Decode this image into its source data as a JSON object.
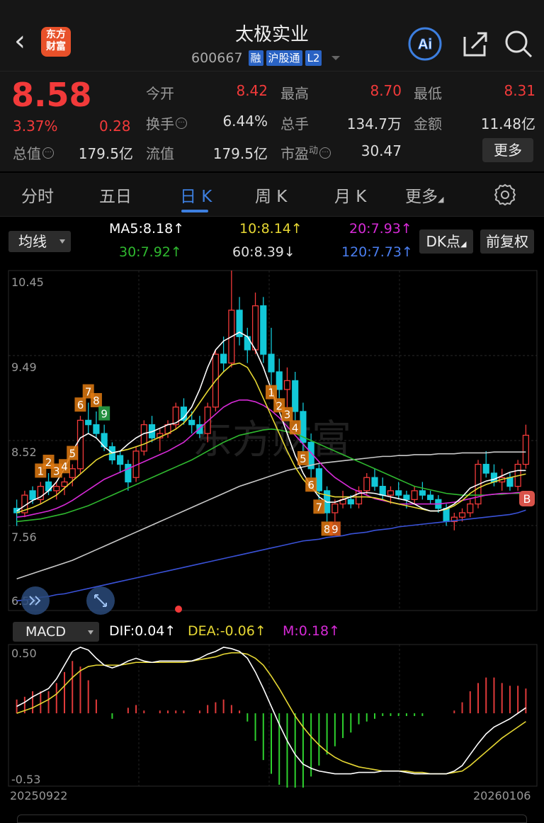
{
  "header": {
    "logo_line1": "东方",
    "logo_line2": "财富",
    "title": "太极实业",
    "code": "600667",
    "tags": [
      "融",
      "沪股通",
      "L2"
    ]
  },
  "quote": {
    "price": "8.58",
    "pct": "3.37%",
    "change": "0.28",
    "open_label": "今开",
    "open": "8.42",
    "high_label": "最高",
    "high": "8.70",
    "low_label": "最低",
    "low": "8.31",
    "turnover_label": "换手",
    "turnover": "6.44%",
    "volume_label": "总手",
    "volume": "134.7万",
    "amount_label": "金额",
    "amount": "11.48亿",
    "mktcap_label": "总值",
    "mktcap": "179.5亿",
    "float_label": "流值",
    "float_cap": "179.5亿",
    "pe_label": "市盈",
    "pe_sup": "动",
    "pe": "30.47",
    "more": "更多"
  },
  "tabs": [
    "分时",
    "五日",
    "日 K",
    "周 K",
    "月 K",
    "更多"
  ],
  "ma": {
    "select": "均线",
    "ma5": "MA5:8.18",
    "ma10": "10:8.14",
    "ma20": "20:7.93",
    "ma30": "30:7.92",
    "ma60": "60:8.39",
    "ma120": "120:7.73",
    "up_arrow": "↑",
    "down_arrow": "↓",
    "dk_btn": "DK点",
    "fq_btn": "前复权"
  },
  "colors": {
    "up": "#f23a3a",
    "down": "#12c8d8",
    "ma5": "#ffffff",
    "ma10": "#e6d733",
    "ma20": "#d62ad6",
    "ma30": "#2fb82f",
    "ma60": "#c8c8c8",
    "ma120": "#3a52d8",
    "accent": "#3d7fe0"
  },
  "chart_data": [
    {
      "type": "candlestick",
      "y_ticks": [
        "10.45",
        "9.49",
        "8.52",
        "7.56",
        "6.59"
      ],
      "ylim": [
        6.59,
        10.45
      ],
      "x_start": "20250922",
      "x_end": "20260106",
      "candles": [
        [
          7.75,
          7.85,
          7.55,
          7.7
        ],
        [
          7.7,
          7.95,
          7.65,
          7.9
        ],
        [
          7.95,
          8.0,
          7.8,
          7.85
        ],
        [
          7.85,
          8.05,
          7.8,
          8.0
        ],
        [
          8.05,
          8.15,
          7.9,
          7.95
        ],
        [
          7.95,
          8.05,
          7.85,
          8.0
        ],
        [
          8.0,
          8.1,
          7.9,
          8.05
        ],
        [
          8.1,
          8.25,
          8.0,
          8.2
        ],
        [
          8.2,
          8.8,
          8.15,
          8.75
        ],
        [
          8.75,
          8.95,
          8.6,
          8.7
        ],
        [
          8.7,
          8.85,
          8.55,
          8.6
        ],
        [
          8.6,
          8.7,
          8.4,
          8.45
        ],
        [
          8.45,
          8.5,
          8.25,
          8.3
        ],
        [
          8.35,
          8.4,
          8.15,
          8.25
        ],
        [
          8.25,
          8.3,
          7.95,
          8.05
        ],
        [
          8.1,
          8.45,
          8.05,
          8.4
        ],
        [
          8.4,
          8.75,
          8.35,
          8.7
        ],
        [
          8.7,
          8.8,
          8.5,
          8.55
        ],
        [
          8.55,
          8.65,
          8.4,
          8.6
        ],
        [
          8.6,
          8.75,
          8.55,
          8.7
        ],
        [
          8.7,
          8.95,
          8.65,
          8.9
        ],
        [
          8.9,
          9.0,
          8.7,
          8.75
        ],
        [
          8.75,
          8.85,
          8.6,
          8.7
        ],
        [
          8.7,
          8.8,
          8.55,
          8.6
        ],
        [
          8.6,
          8.95,
          8.5,
          8.9
        ],
        [
          8.9,
          9.55,
          8.85,
          9.5
        ],
        [
          9.5,
          9.7,
          9.3,
          9.4
        ],
        [
          9.4,
          10.45,
          9.35,
          10.0
        ],
        [
          10.0,
          10.15,
          9.6,
          9.7
        ],
        [
          9.7,
          9.8,
          9.4,
          9.55
        ],
        [
          9.55,
          10.2,
          9.5,
          10.05
        ],
        [
          10.05,
          10.15,
          9.4,
          9.5
        ],
        [
          9.5,
          9.8,
          9.15,
          9.3
        ],
        [
          9.3,
          9.45,
          9.0,
          9.1
        ],
        [
          9.1,
          9.35,
          8.9,
          9.2
        ],
        [
          9.2,
          9.3,
          8.75,
          8.85
        ],
        [
          8.85,
          8.95,
          8.4,
          8.5
        ],
        [
          8.5,
          8.6,
          8.1,
          8.2
        ],
        [
          8.2,
          8.25,
          7.85,
          7.95
        ],
        [
          7.95,
          8.0,
          7.6,
          7.7
        ],
        [
          7.7,
          7.85,
          7.6,
          7.8
        ],
        [
          7.8,
          7.95,
          7.75,
          7.85
        ],
        [
          7.85,
          7.9,
          7.75,
          7.8
        ],
        [
          7.8,
          8.0,
          7.75,
          7.95
        ],
        [
          7.95,
          8.15,
          7.9,
          8.1
        ],
        [
          8.1,
          8.2,
          7.95,
          8.0
        ],
        [
          8.0,
          8.1,
          7.85,
          7.9
        ],
        [
          7.9,
          8.0,
          7.8,
          7.95
        ],
        [
          7.95,
          8.05,
          7.85,
          7.9
        ],
        [
          7.9,
          7.95,
          7.75,
          7.85
        ],
        [
          7.85,
          8.0,
          7.8,
          7.95
        ],
        [
          7.95,
          8.05,
          7.85,
          7.9
        ],
        [
          7.9,
          7.95,
          7.8,
          7.85
        ],
        [
          7.85,
          7.9,
          7.7,
          7.75
        ],
        [
          7.75,
          7.8,
          7.55,
          7.6
        ],
        [
          7.6,
          7.7,
          7.5,
          7.65
        ],
        [
          7.65,
          7.75,
          7.6,
          7.7
        ],
        [
          7.7,
          7.85,
          7.65,
          7.8
        ],
        [
          7.8,
          8.3,
          7.75,
          8.25
        ],
        [
          8.25,
          8.4,
          8.1,
          8.15
        ],
        [
          8.15,
          8.25,
          8.0,
          8.05
        ],
        [
          8.05,
          8.2,
          7.95,
          8.1
        ],
        [
          8.1,
          8.15,
          7.95,
          8.0
        ],
        [
          8.0,
          8.3,
          7.95,
          8.25
        ],
        [
          8.25,
          8.7,
          8.2,
          8.58
        ]
      ],
      "ma5": [
        7.72,
        7.78,
        7.84,
        7.88,
        7.95,
        8.05,
        8.2,
        8.4,
        8.55,
        8.6,
        8.55,
        8.45,
        8.38,
        8.4,
        8.48,
        8.55,
        8.6,
        8.62,
        8.66,
        8.7,
        8.72,
        8.78,
        8.9,
        9.1,
        9.35,
        9.55,
        9.65,
        9.7,
        9.75,
        9.7,
        9.55,
        9.35,
        9.1,
        8.85,
        8.6,
        8.35,
        8.15,
        8.0,
        7.88,
        7.82,
        7.82,
        7.85,
        7.88,
        7.92,
        7.93,
        7.92,
        7.9,
        7.88,
        7.86,
        7.84,
        7.8,
        7.75,
        7.72,
        7.72,
        7.75,
        7.8,
        7.88,
        7.98,
        8.02,
        8.06,
        8.08,
        8.12,
        8.16,
        8.18,
        8.18
      ],
      "ma10": [
        7.7,
        7.73,
        7.76,
        7.8,
        7.85,
        7.9,
        7.98,
        8.06,
        8.14,
        8.22,
        8.3,
        8.35,
        8.38,
        8.4,
        8.42,
        8.45,
        8.48,
        8.52,
        8.56,
        8.6,
        8.65,
        8.72,
        8.82,
        8.95,
        9.08,
        9.2,
        9.3,
        9.38,
        9.4,
        9.35,
        9.2,
        9.0,
        8.8,
        8.6,
        8.4,
        8.22,
        8.08,
        7.98,
        7.92,
        7.9,
        7.88,
        7.88,
        7.88,
        7.88,
        7.88,
        7.87,
        7.85,
        7.82,
        7.8,
        7.78,
        7.76,
        7.74,
        7.72,
        7.72,
        7.74,
        7.78,
        7.84,
        7.92,
        7.98,
        8.02,
        8.05,
        8.08,
        8.1,
        8.12,
        8.14
      ],
      "ma20": [
        7.65,
        7.66,
        7.68,
        7.7,
        7.72,
        7.75,
        7.79,
        7.84,
        7.9,
        7.96,
        8.02,
        8.08,
        8.12,
        8.16,
        8.2,
        8.24,
        8.28,
        8.32,
        8.36,
        8.4,
        8.45,
        8.5,
        8.58,
        8.66,
        8.74,
        8.82,
        8.9,
        8.95,
        8.98,
        8.98,
        8.96,
        8.92,
        8.86,
        8.78,
        8.68,
        8.58,
        8.48,
        8.38,
        8.28,
        8.18,
        8.1,
        8.04,
        7.98,
        7.94,
        7.9,
        7.86,
        7.84,
        7.82,
        7.8,
        7.8,
        7.8,
        7.8,
        7.8,
        7.8,
        7.81,
        7.82,
        7.84,
        7.86,
        7.88,
        7.9,
        7.91,
        7.92,
        7.92,
        7.93,
        7.93
      ],
      "ma30": [
        7.6,
        7.61,
        7.62,
        7.63,
        7.65,
        7.67,
        7.69,
        7.72,
        7.75,
        7.78,
        7.82,
        7.86,
        7.9,
        7.94,
        7.98,
        8.02,
        8.06,
        8.1,
        8.14,
        8.18,
        8.22,
        8.26,
        8.3,
        8.35,
        8.4,
        8.45,
        8.5,
        8.54,
        8.58,
        8.6,
        8.62,
        8.64,
        8.65,
        8.64,
        8.62,
        8.6,
        8.56,
        8.52,
        8.48,
        8.44,
        8.4,
        8.36,
        8.32,
        8.28,
        8.24,
        8.2,
        8.16,
        8.12,
        8.08,
        8.04,
        8.0,
        7.98,
        7.96,
        7.94,
        7.92,
        7.91,
        7.9,
        7.9,
        7.9,
        7.9,
        7.91,
        7.91,
        7.92,
        7.92,
        7.92
      ],
      "ma60": [
        6.95,
        6.98,
        7.01,
        7.04,
        7.07,
        7.1,
        7.13,
        7.16,
        7.2,
        7.24,
        7.28,
        7.32,
        7.36,
        7.4,
        7.44,
        7.48,
        7.52,
        7.56,
        7.6,
        7.64,
        7.68,
        7.72,
        7.76,
        7.8,
        7.84,
        7.88,
        7.92,
        7.96,
        8.0,
        8.03,
        8.06,
        8.09,
        8.12,
        8.15,
        8.18,
        8.2,
        8.22,
        8.24,
        8.26,
        8.27,
        8.28,
        8.29,
        8.3,
        8.31,
        8.32,
        8.33,
        8.34,
        8.34,
        8.35,
        8.35,
        8.36,
        8.36,
        8.36,
        8.37,
        8.37,
        8.37,
        8.38,
        8.38,
        8.38,
        8.38,
        8.39,
        8.39,
        8.39,
        8.39,
        8.39
      ],
      "ma120": [
        6.7,
        6.71,
        6.72,
        6.74,
        6.75,
        6.77,
        6.78,
        6.8,
        6.82,
        6.84,
        6.86,
        6.88,
        6.9,
        6.92,
        6.94,
        6.96,
        6.98,
        7.0,
        7.02,
        7.04,
        7.06,
        7.08,
        7.1,
        7.12,
        7.14,
        7.16,
        7.18,
        7.2,
        7.22,
        7.24,
        7.26,
        7.28,
        7.3,
        7.32,
        7.34,
        7.36,
        7.38,
        7.39,
        7.4,
        7.42,
        7.43,
        7.44,
        7.46,
        7.47,
        7.48,
        7.5,
        7.51,
        7.52,
        7.54,
        7.55,
        7.56,
        7.57,
        7.58,
        7.59,
        7.6,
        7.61,
        7.62,
        7.63,
        7.64,
        7.65,
        7.66,
        7.67,
        7.68,
        7.7,
        7.73
      ],
      "markers": [
        {
          "i": 3,
          "text": "1",
          "color": "#e07a10"
        },
        {
          "i": 4,
          "text": "2",
          "color": "#e07a10"
        },
        {
          "i": 5,
          "text": "3",
          "color": "#e07a10"
        },
        {
          "i": 6,
          "text": "4",
          "color": "#e07a10"
        },
        {
          "i": 7,
          "text": "5",
          "color": "#e07a10"
        },
        {
          "i": 8,
          "text": "6",
          "color": "#e07a10"
        },
        {
          "i": 9,
          "text": "7",
          "color": "#e07a10"
        },
        {
          "i": 10,
          "text": "8",
          "color": "#e07a10"
        },
        {
          "i": 11,
          "text": "9",
          "color": "#2aa84a"
        },
        {
          "i": 32,
          "text": "1",
          "color": "#e07a10"
        },
        {
          "i": 33,
          "text": "2",
          "color": "#e07a10"
        },
        {
          "i": 34,
          "text": "3",
          "color": "#e07a10"
        },
        {
          "i": 35,
          "text": "4",
          "color": "#e07a10"
        },
        {
          "i": 36,
          "text": "5",
          "color": "#e07a10"
        },
        {
          "i": 37,
          "text": "6",
          "color": "#e07a10"
        },
        {
          "i": 38,
          "text": "7",
          "color": "#e07a10"
        },
        {
          "i": 39,
          "text": "8",
          "color": "#e07a10"
        },
        {
          "i": 40,
          "text": "9",
          "color": "#e0601a"
        }
      ],
      "b_marker": "B"
    },
    {
      "type": "macd",
      "y_ticks": [
        "0.50",
        "-0.53"
      ],
      "ylim": [
        -0.53,
        0.5
      ],
      "dif": [
        0.05,
        0.08,
        0.12,
        0.15,
        0.18,
        0.25,
        0.35,
        0.45,
        0.48,
        0.46,
        0.4,
        0.35,
        0.33,
        0.35,
        0.38,
        0.4,
        0.38,
        0.37,
        0.38,
        0.38,
        0.38,
        0.38,
        0.38,
        0.4,
        0.43,
        0.45,
        0.48,
        0.47,
        0.45,
        0.4,
        0.3,
        0.18,
        0.05,
        -0.08,
        -0.2,
        -0.3,
        -0.37,
        -0.4,
        -0.42,
        -0.43,
        -0.44,
        -0.44,
        -0.44,
        -0.43,
        -0.43,
        -0.43,
        -0.42,
        -0.42,
        -0.42,
        -0.43,
        -0.44,
        -0.44,
        -0.44,
        -0.44,
        -0.44,
        -0.42,
        -0.38,
        -0.3,
        -0.22,
        -0.15,
        -0.1,
        -0.07,
        -0.04,
        0.0,
        0.04
      ],
      "dea": [
        0.0,
        0.02,
        0.04,
        0.07,
        0.1,
        0.14,
        0.2,
        0.26,
        0.31,
        0.34,
        0.35,
        0.35,
        0.35,
        0.35,
        0.36,
        0.37,
        0.37,
        0.37,
        0.37,
        0.37,
        0.37,
        0.37,
        0.38,
        0.39,
        0.4,
        0.41,
        0.43,
        0.44,
        0.44,
        0.43,
        0.4,
        0.35,
        0.27,
        0.18,
        0.08,
        -0.02,
        -0.1,
        -0.17,
        -0.23,
        -0.28,
        -0.32,
        -0.35,
        -0.37,
        -0.39,
        -0.4,
        -0.41,
        -0.42,
        -0.42,
        -0.42,
        -0.42,
        -0.43,
        -0.43,
        -0.44,
        -0.44,
        -0.44,
        -0.43,
        -0.42,
        -0.38,
        -0.33,
        -0.28,
        -0.23,
        -0.18,
        -0.14,
        -0.1,
        -0.06
      ],
      "macd": [
        0.1,
        0.12,
        0.16,
        0.16,
        0.16,
        0.22,
        0.3,
        0.38,
        0.34,
        0.24,
        0.1,
        0.0,
        -0.04,
        0.0,
        0.04,
        0.06,
        0.02,
        0.0,
        0.02,
        0.02,
        0.02,
        0.02,
        0.0,
        0.02,
        0.06,
        0.08,
        0.1,
        0.06,
        0.02,
        -0.06,
        -0.2,
        -0.34,
        -0.44,
        -0.52,
        -0.56,
        -0.56,
        -0.54,
        -0.46,
        -0.38,
        -0.3,
        -0.24,
        -0.18,
        -0.14,
        -0.08,
        -0.06,
        -0.04,
        -0.02,
        -0.02,
        -0.02,
        -0.02,
        -0.02,
        -0.02,
        0.0,
        0.0,
        0.0,
        0.02,
        0.08,
        0.16,
        0.22,
        0.26,
        0.26,
        0.22,
        0.2,
        0.2,
        0.18
      ]
    }
  ],
  "macd_bar": {
    "select": "MACD",
    "dif": "DIF:0.04",
    "dea": "DEA:-0.06",
    "m": "M:0.18",
    "up_arrow": "↑"
  },
  "dates": {
    "start": "20250922",
    "end": "20260106"
  }
}
